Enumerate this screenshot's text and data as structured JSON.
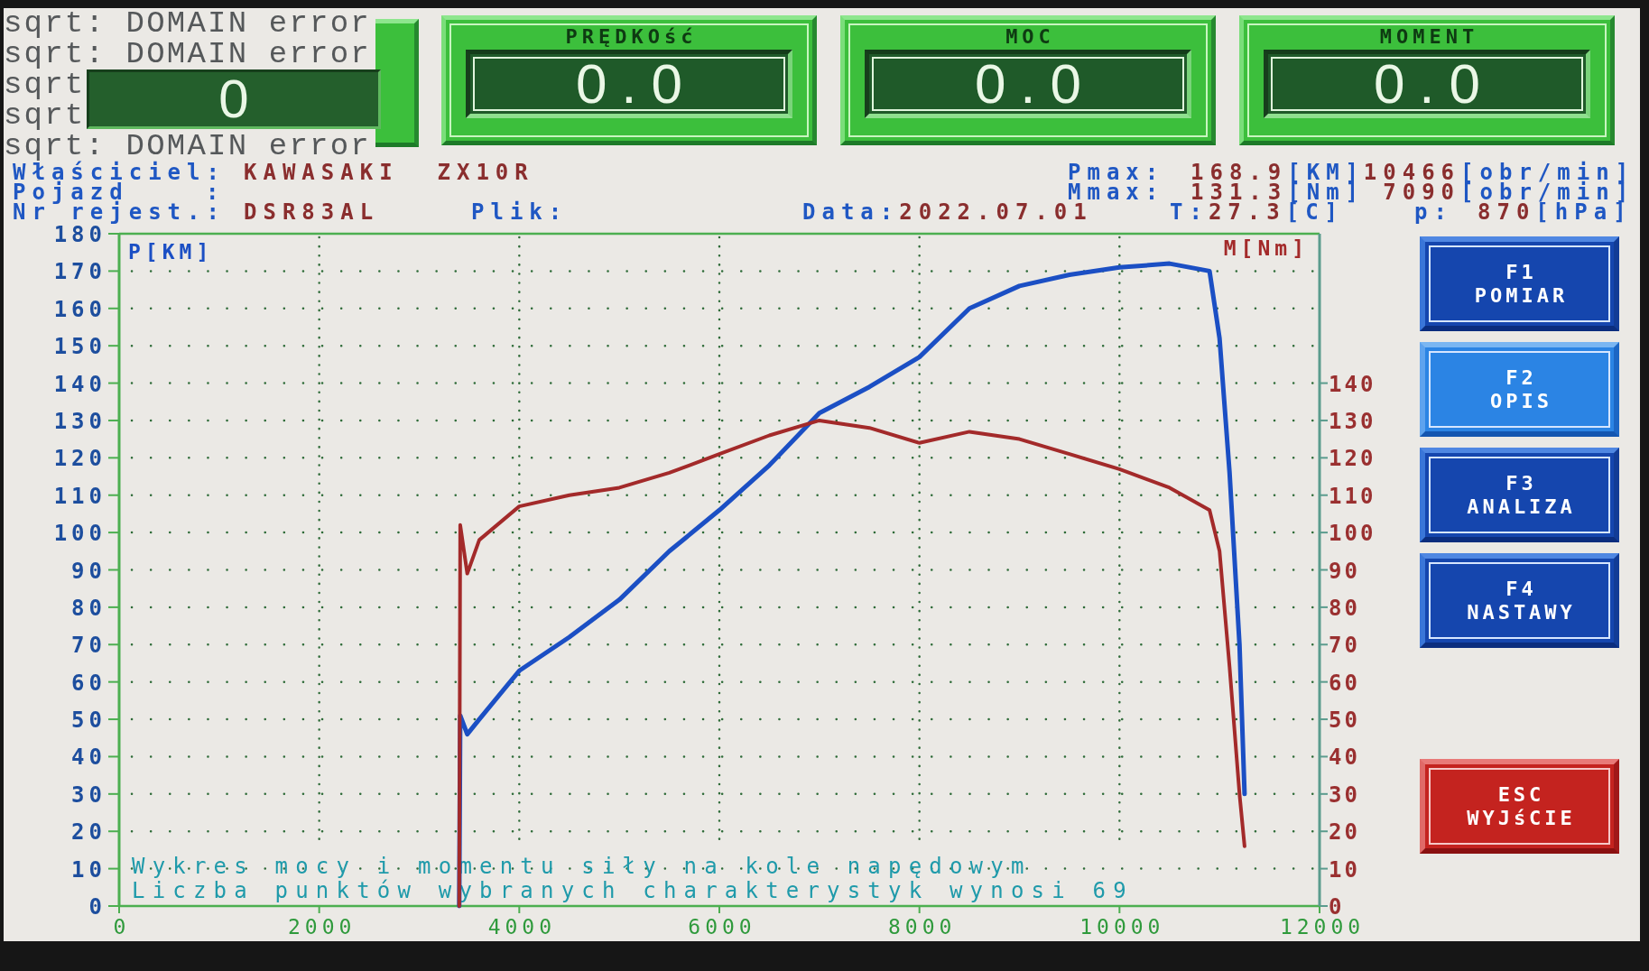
{
  "console_lines": [
    "sqrt: DOMAIN error",
    "sqrt: DOMAIN error",
    "sqrt",
    "sqrt",
    "sqrt: DOMAIN error"
  ],
  "covered_gauge": {
    "value": "0"
  },
  "gauges": [
    {
      "title": "PRĘDKOść",
      "value": "0.0"
    },
    {
      "title": "MOC",
      "value": "0.0"
    },
    {
      "title": "MOMENT",
      "value": "0.0"
    }
  ],
  "info": {
    "owner": {
      "label": "Właściciel:",
      "value": "KAWASAKI  ZX10R"
    },
    "vehicle": {
      "label": "Pojazd",
      "colon": ":"
    },
    "registration": {
      "label": "Nr rejest.:",
      "value": "DSR83AL"
    },
    "file": {
      "label": "Plik:"
    },
    "date": {
      "label": "Data:",
      "value": "2022.07.01"
    },
    "pmax": {
      "label": "Pmax:",
      "value": "168.9",
      "unit": "[KM]",
      "rpm": "10466",
      "rpm_unit": "[obr/min]"
    },
    "mmax": {
      "label": "Mmax:",
      "value": "131.3",
      "unit": "[Nm]",
      "rpm": "7090",
      "rpm_unit": "[obr/min]"
    },
    "temperature": {
      "label": "T:",
      "value": "27.3",
      "unit": "[C]"
    },
    "pressure": {
      "label": "p:",
      "value": "870",
      "unit": "[hPa]"
    }
  },
  "chart": {
    "chart_data": {
      "type": "line",
      "x": [
        3400,
        3410,
        3480,
        3600,
        4000,
        4500,
        5000,
        5500,
        6000,
        6500,
        7000,
        7500,
        8000,
        8500,
        9000,
        9500,
        10000,
        10500,
        10900,
        11000,
        11100,
        11200,
        11250
      ],
      "series": [
        {
          "name": "P[KM]",
          "color": "#1b4fc4",
          "values": [
            0,
            51,
            46,
            50,
            63,
            72,
            82,
            95,
            106,
            118,
            132,
            139,
            147,
            160,
            166,
            169,
            171,
            172,
            170,
            152,
            116,
            70,
            30
          ]
        },
        {
          "name": "M[Nm]",
          "color": "#a32a2a",
          "values": [
            0,
            102,
            89,
            98,
            107,
            110,
            112,
            116,
            121,
            126,
            130,
            128,
            124,
            127,
            125,
            121,
            117,
            112,
            106,
            95,
            64,
            30,
            16
          ]
        }
      ],
      "xlim": [
        0,
        12000
      ],
      "ylim": [
        0,
        180
      ],
      "xticks": [
        0,
        2000,
        4000,
        6000,
        8000,
        10000,
        12000
      ],
      "yticks": [
        0,
        10,
        20,
        30,
        40,
        50,
        60,
        70,
        80,
        90,
        100,
        110,
        120,
        130,
        140,
        150,
        160,
        170,
        180
      ],
      "grid": true
    },
    "right_axis_ticks": [
      "140",
      "130",
      "120",
      "110",
      "100",
      "90",
      "80",
      "70",
      "60",
      "50",
      "40",
      "30",
      "20",
      "10",
      "0"
    ],
    "captions": [
      "Wykres mocy i momentu siły na kole napędowym",
      "Liczba punktów wybranych charakterystyk wynosi 69"
    ]
  },
  "buttons": [
    {
      "kind": "function",
      "key": "F1",
      "label": "POMIAR",
      "selected": false
    },
    {
      "kind": "function",
      "key": "F2",
      "label": "OPIS",
      "selected": true
    },
    {
      "kind": "function",
      "key": "F3",
      "label": "ANALIZA",
      "selected": false
    },
    {
      "kind": "function",
      "key": "F4",
      "label": "NASTAWY",
      "selected": false
    },
    {
      "kind": "exit",
      "key": "ESC",
      "label": "WYJśCIE",
      "selected": false
    }
  ]
}
